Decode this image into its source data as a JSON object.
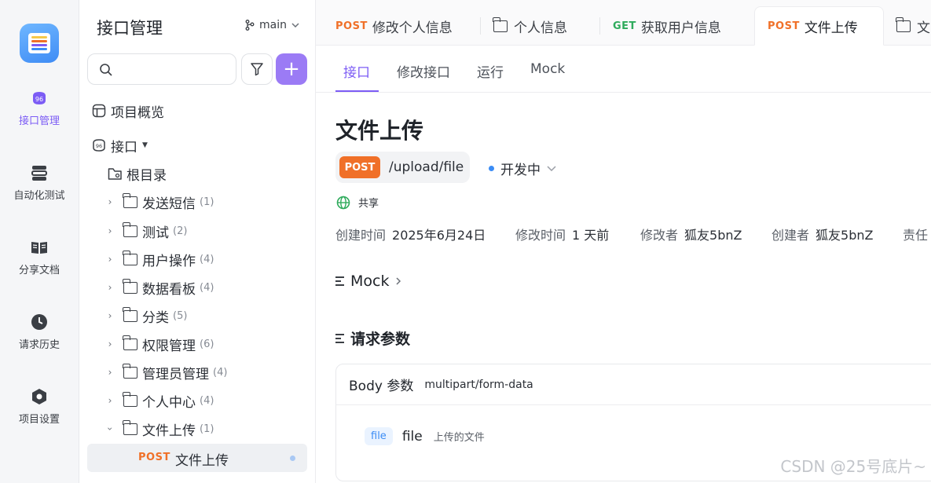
{
  "rail": {
    "items": [
      {
        "label": "接口管理",
        "icon": "api-icon"
      },
      {
        "label": "自动化测试",
        "icon": "automation-icon"
      },
      {
        "label": "分享文档",
        "icon": "book-icon"
      },
      {
        "label": "请求历史",
        "icon": "clock-icon"
      },
      {
        "label": "项目设置",
        "icon": "settings-icon"
      }
    ],
    "accent": "#7c5cf5"
  },
  "sidebar": {
    "title": "接口管理",
    "branch": "main",
    "overview": "项目概览",
    "api_root": "接口",
    "root_dir": "根目录",
    "folders": [
      {
        "name": "发送短信",
        "count": "(1)"
      },
      {
        "name": "测试",
        "count": "(2)"
      },
      {
        "name": "用户操作",
        "count": "(4)"
      },
      {
        "name": "数据看板",
        "count": "(4)"
      },
      {
        "name": "分类",
        "count": "(5)"
      },
      {
        "name": "权限管理",
        "count": "(6)"
      },
      {
        "name": "管理员管理",
        "count": "(4)"
      },
      {
        "name": "个人中心",
        "count": "(4)"
      },
      {
        "name": "文件上传",
        "count": "(1)"
      }
    ],
    "selected_item": {
      "method": "POST",
      "name": "文件上传"
    },
    "add_label": "+"
  },
  "tabs": [
    {
      "method": "POST",
      "label": "修改个人信息"
    },
    {
      "method": "",
      "label": "个人信息"
    },
    {
      "method": "GET",
      "label": "获取用户信息"
    },
    {
      "method": "POST",
      "label": "文件上传"
    },
    {
      "method": "",
      "label": "文"
    }
  ],
  "subtabs": [
    "接口",
    "修改接口",
    "运行",
    "Mock"
  ],
  "main": {
    "title": "文件上传",
    "method": "POST",
    "url": "/upload/file",
    "status": "开发中",
    "share": "共享",
    "meta": [
      {
        "label": "创建时间",
        "value": "2025年6月24日"
      },
      {
        "label": "修改时间",
        "value": "1 天前"
      },
      {
        "label": "修改者",
        "value": "狐友5bnZ"
      },
      {
        "label": "创建者",
        "value": "狐友5bnZ"
      },
      {
        "label": "责任",
        "value": ""
      }
    ],
    "mock_section": "Mock",
    "request_section": "请求参数",
    "body": {
      "label": "Body 参数",
      "content_type": "multipart/form-data",
      "param": {
        "type": "file",
        "name": "file",
        "desc": "上传的文件"
      }
    }
  },
  "watermark": "CSDN @25号底片~",
  "colors": {
    "post": "#f07028",
    "get": "#2fab5c",
    "status_dot": "#3b8cf5"
  }
}
